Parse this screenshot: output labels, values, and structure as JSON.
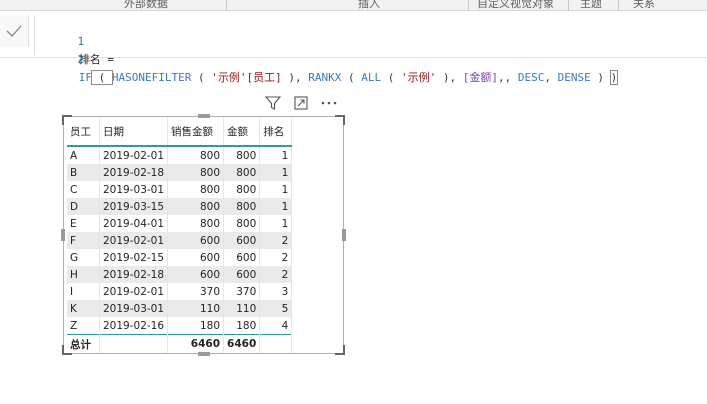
{
  "ribbon": {
    "items": [
      "外部数据",
      "插入",
      "自定义视觉对象",
      "主题",
      "关系"
    ]
  },
  "formula": {
    "line1_num": "1",
    "line1_text": "排名 =",
    "line2_num": "2",
    "t_if": "IF",
    "t_p1": " ( ",
    "t_hasone": "HASONEFILTER",
    "t_p2": " ( ",
    "t_col": "'示例'[员工]",
    "t_p3": " ), ",
    "t_rankx": "RANKX",
    "t_p4": " ( ",
    "t_all": "ALL",
    "t_p5": " ( ",
    "t_tbl": "'示例'",
    "t_p6": " ), ",
    "t_measure": "[金额]",
    "t_p7": ",, ",
    "t_desc": "DESC",
    "t_p8": ", ",
    "t_dense": "DENSE",
    "t_p9": " ) ",
    "t_end": ")"
  },
  "table": {
    "headers": [
      "员工",
      "日期",
      "销售金额",
      "金额",
      "排名"
    ],
    "rows": [
      [
        "A",
        "2019-02-01",
        "800",
        "800",
        "1"
      ],
      [
        "B",
        "2019-02-18",
        "800",
        "800",
        "1"
      ],
      [
        "C",
        "2019-03-01",
        "800",
        "800",
        "1"
      ],
      [
        "D",
        "2019-03-15",
        "800",
        "800",
        "1"
      ],
      [
        "E",
        "2019-04-01",
        "800",
        "800",
        "1"
      ],
      [
        "F",
        "2019-02-01",
        "600",
        "600",
        "2"
      ],
      [
        "G",
        "2019-02-15",
        "600",
        "600",
        "2"
      ],
      [
        "H",
        "2019-02-18",
        "600",
        "600",
        "2"
      ],
      [
        "I",
        "2019-02-01",
        "370",
        "370",
        "3"
      ],
      [
        "K",
        "2019-03-01",
        "110",
        "110",
        "5"
      ],
      [
        "Z",
        "2019-02-16",
        "180",
        "180",
        "4"
      ]
    ],
    "total": [
      "总计",
      "",
      "6460",
      "6460",
      ""
    ]
  },
  "icons": {
    "commit": "checkmark-icon",
    "filter": "filter-icon",
    "focus": "focus-mode-icon",
    "more": "more-options-icon"
  },
  "colors": {
    "accent": "#2d9ca0",
    "row_alt": "#eaeaea"
  }
}
